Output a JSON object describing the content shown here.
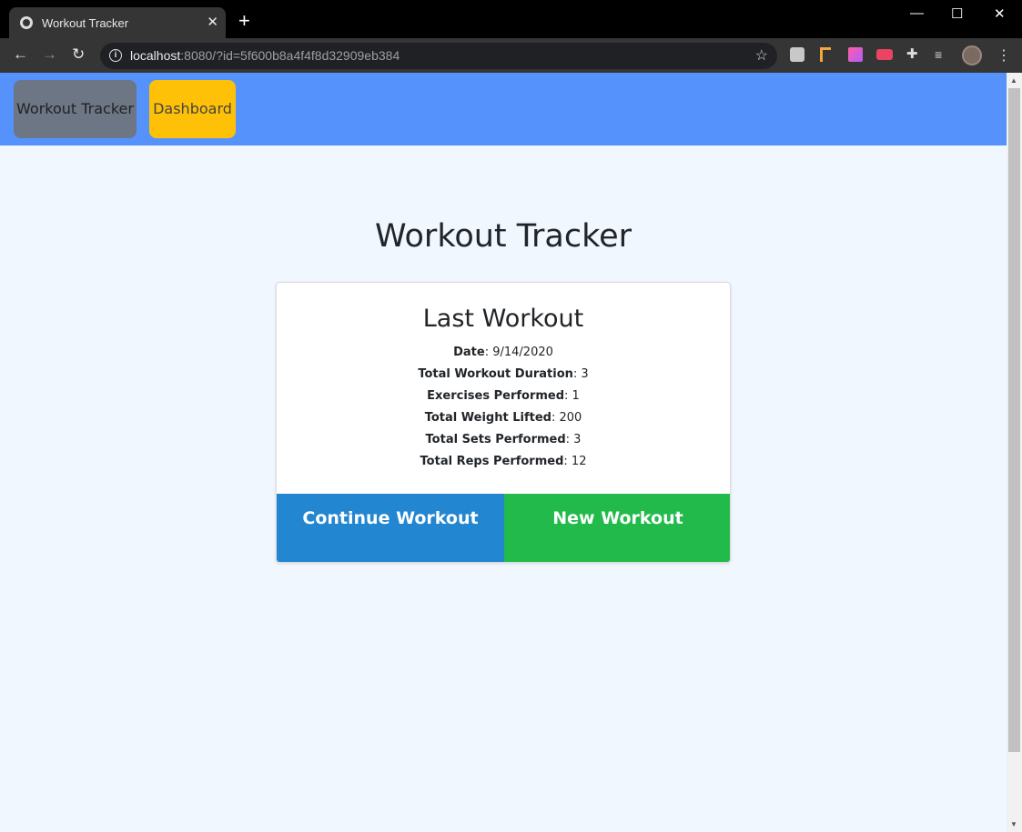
{
  "browser": {
    "tab_title": "Workout Tracker",
    "tab_close": "✕",
    "new_tab": "+",
    "window_controls": {
      "minimize": "—",
      "maximize": "☐",
      "close": "✕"
    },
    "nav": {
      "back": "←",
      "forward": "→",
      "reload": "↻"
    },
    "address": {
      "host": "localhost",
      "rest": ":8080/?id=5f600b8a4f4f8d32909eb384"
    },
    "icons": [
      "info-icon",
      "star-icon",
      "extension-icon",
      "puzzle-icon",
      "media-icon",
      "avatar",
      "menu-icon"
    ],
    "menu": "⋮",
    "star": "☆"
  },
  "site": {
    "nav": {
      "home_label": "Workout Tracker",
      "dashboard_label": "Dashboard"
    },
    "title": "Workout Tracker",
    "colors": {
      "nav_bg": "#5592fc",
      "continue": "#2286d1",
      "new": "#22bb4b",
      "dashboard": "#ffc107"
    }
  },
  "last_workout": {
    "heading": "Last Workout",
    "stats": [
      {
        "label": "Date",
        "value": ": 9/14/2020"
      },
      {
        "label": "Total Workout Duration",
        "value": ": 3"
      },
      {
        "label": "Exercises Performed",
        "value": ": 1"
      },
      {
        "label": "Total Weight Lifted",
        "value": ": 200"
      },
      {
        "label": "Total Sets Performed",
        "value": ": 3"
      },
      {
        "label": "Total Reps Performed",
        "value": ": 12"
      }
    ],
    "continue_label": "Continue Workout",
    "new_label": "New Workout"
  }
}
